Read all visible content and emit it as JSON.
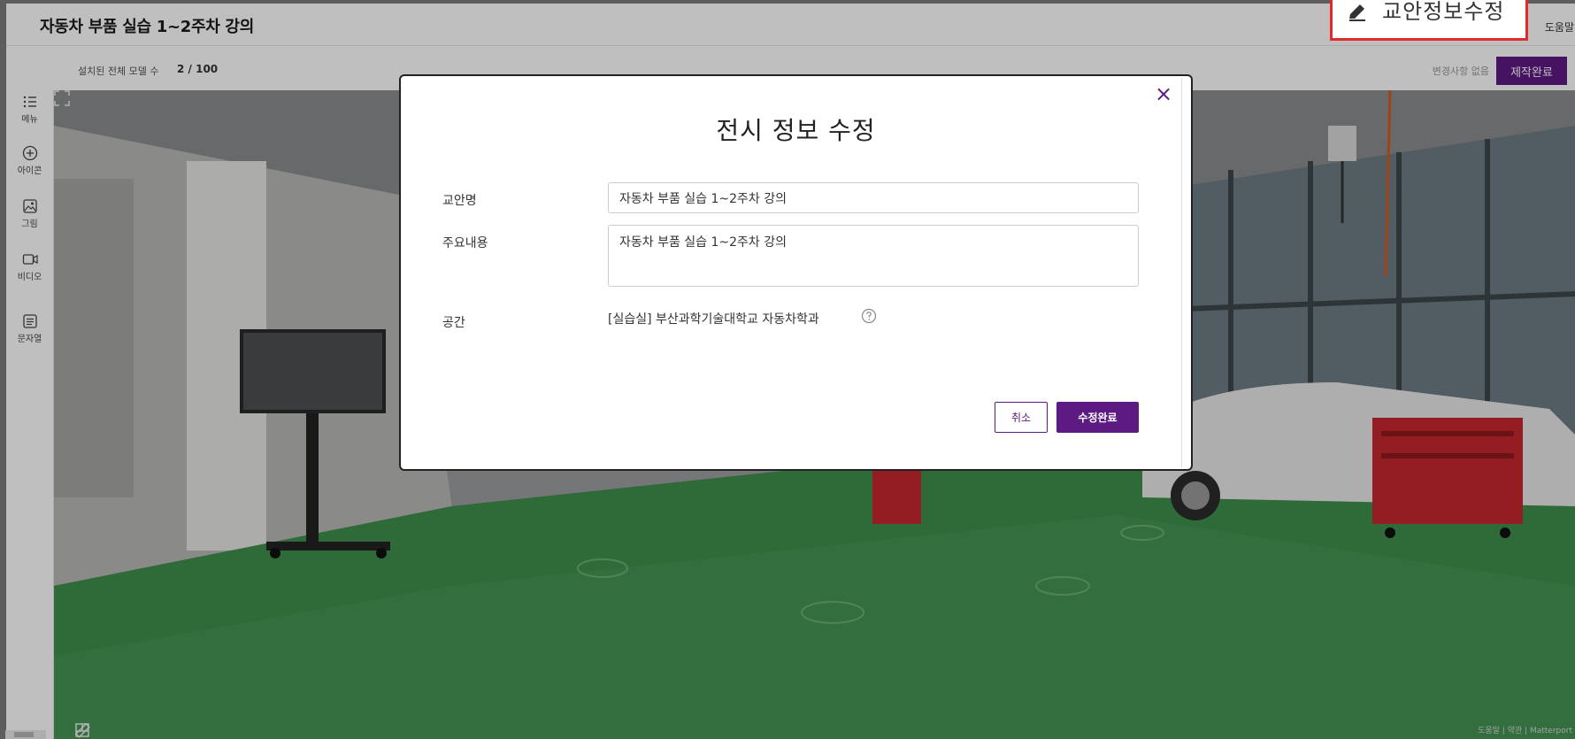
{
  "header": {
    "title": "자동차 부품 실습 1~2주차 강의",
    "help_label": "도움말"
  },
  "subbar": {
    "model_count_label": "설치된 전체 모델 수",
    "model_count_value": "2 / 100",
    "change_status": "변경사항 없음",
    "finish_label": "제작완료"
  },
  "sidebar": {
    "items": [
      {
        "label": "메뉴",
        "icon": "menu-list-icon"
      },
      {
        "label": "아이콘",
        "icon": "add-circle-icon"
      },
      {
        "label": "그림",
        "icon": "image-icon"
      },
      {
        "label": "비디오",
        "icon": "video-icon"
      },
      {
        "label": "문자열",
        "icon": "text-box-icon"
      }
    ]
  },
  "viewer": {
    "credit": "도움말 | 약관 | Matterport"
  },
  "modal": {
    "title": "전시 정보 수정",
    "fields": {
      "lesson_name_label": "교안명",
      "lesson_name_value": "자동차 부품 실습 1~2주차 강의",
      "content_label": "주요내용",
      "content_value": "자동차 부품 실습 1~2주차 강의",
      "space_label": "공간",
      "space_value": "[실습실] 부산과학기술대학교 자동차학과"
    },
    "close_symbol": "×",
    "cancel_label": "취소",
    "confirm_label": "수정완료"
  },
  "callout": {
    "text": "교안정보수정",
    "border_color": "#e12b2b"
  },
  "colors": {
    "accent": "#5d1a82",
    "callout_border": "#e12b2b"
  }
}
